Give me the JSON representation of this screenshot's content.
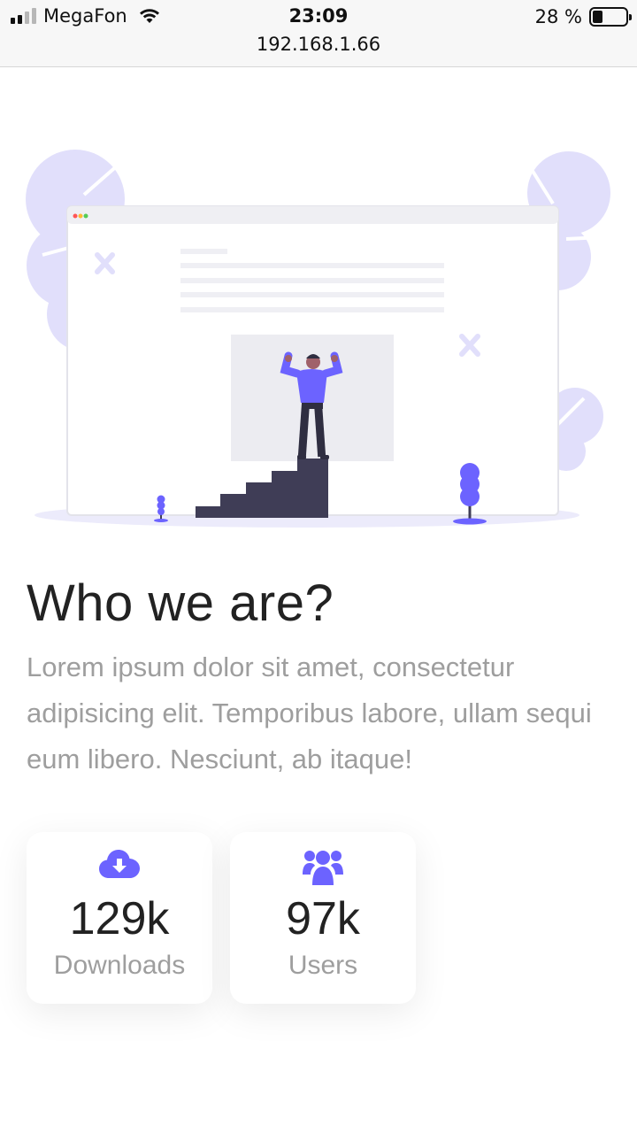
{
  "status_bar": {
    "carrier": "MegaFon",
    "time": "23:09",
    "url": "192.168.1.66",
    "battery": "28 %",
    "battery_level": 0.28
  },
  "hero": {
    "title": "Who we are?",
    "description": "Lorem ipsum dolor sit amet, consectetur adipisicing elit. Temporibus labore, ullam sequi eum libero. Nesciunt, ab itaque!"
  },
  "stats": [
    {
      "icon": "cloud-download-icon",
      "value": "129k",
      "label": "Downloads"
    },
    {
      "icon": "users-icon",
      "value": "97k",
      "label": "Users"
    }
  ],
  "colors": {
    "accent": "#6c63ff",
    "text_dark": "#222222",
    "text_muted": "#9e9e9e",
    "leaf": "#e0defa",
    "stairs": "#3f3d56"
  }
}
